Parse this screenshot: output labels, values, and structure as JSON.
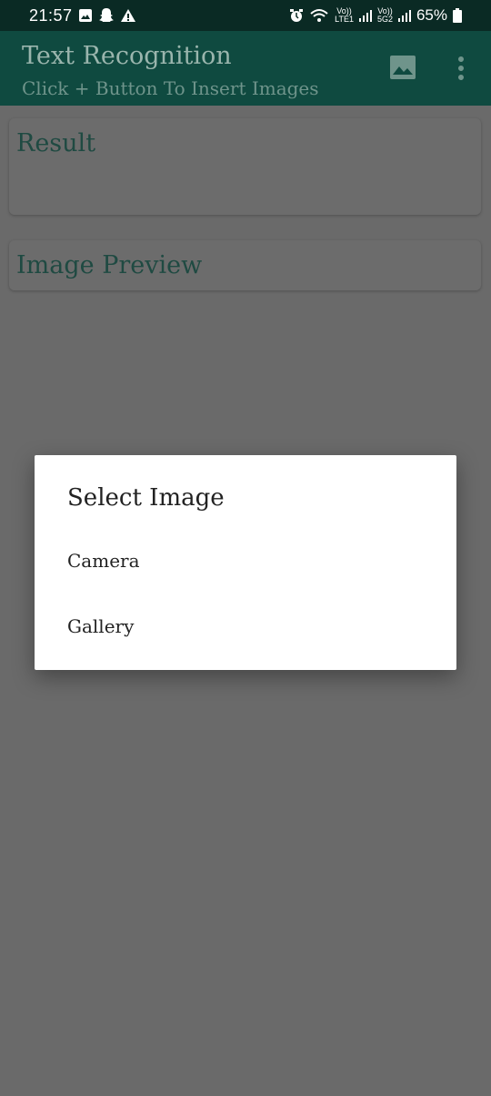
{
  "status_bar": {
    "time": "21:57",
    "lte_label_top": "Vo))",
    "lte_label_bottom": "LTE1",
    "fiveg_label_top": "Vo))",
    "fiveg_label_bottom": "5G2",
    "battery": "65%"
  },
  "app_bar": {
    "title": "Text Recognition",
    "subtitle": "Click + Button To Insert Images",
    "image_icon": "image-icon",
    "menu_icon": "more-vertical-icon"
  },
  "cards": {
    "result_label": "Result",
    "preview_label": "Image Preview"
  },
  "dialog": {
    "title": "Select Image",
    "items": [
      "Camera",
      "Gallery"
    ]
  },
  "colors": {
    "status_bar": "#0a2a24",
    "app_bar": "#0f4a40",
    "scrim_background": "#6a6a6a",
    "dialog_bg": "#ffffff"
  }
}
